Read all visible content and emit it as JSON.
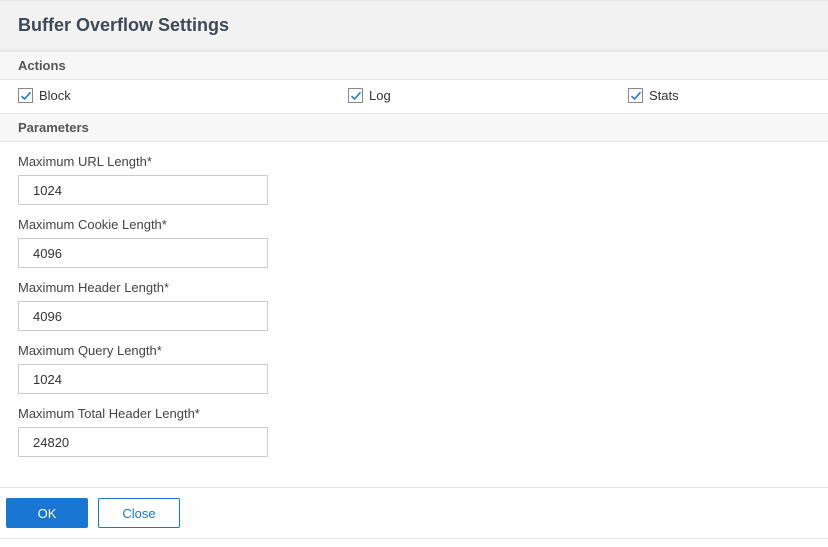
{
  "header": {
    "title": "Buffer Overflow Settings"
  },
  "sections": {
    "actions_label": "Actions",
    "parameters_label": "Parameters"
  },
  "actions": {
    "block": {
      "label": "Block",
      "checked": true
    },
    "log": {
      "label": "Log",
      "checked": true
    },
    "stats": {
      "label": "Stats",
      "checked": true
    }
  },
  "parameters": {
    "max_url_length": {
      "label": "Maximum URL Length*",
      "value": "1024"
    },
    "max_cookie_length": {
      "label": "Maximum Cookie Length*",
      "value": "4096"
    },
    "max_header_length": {
      "label": "Maximum Header Length*",
      "value": "4096"
    },
    "max_query_length": {
      "label": "Maximum Query Length*",
      "value": "1024"
    },
    "max_total_header_length": {
      "label": "Maximum Total Header Length*",
      "value": "24820"
    }
  },
  "footer": {
    "ok_label": "OK",
    "close_label": "Close"
  },
  "colors": {
    "primary": "#1976d2"
  }
}
